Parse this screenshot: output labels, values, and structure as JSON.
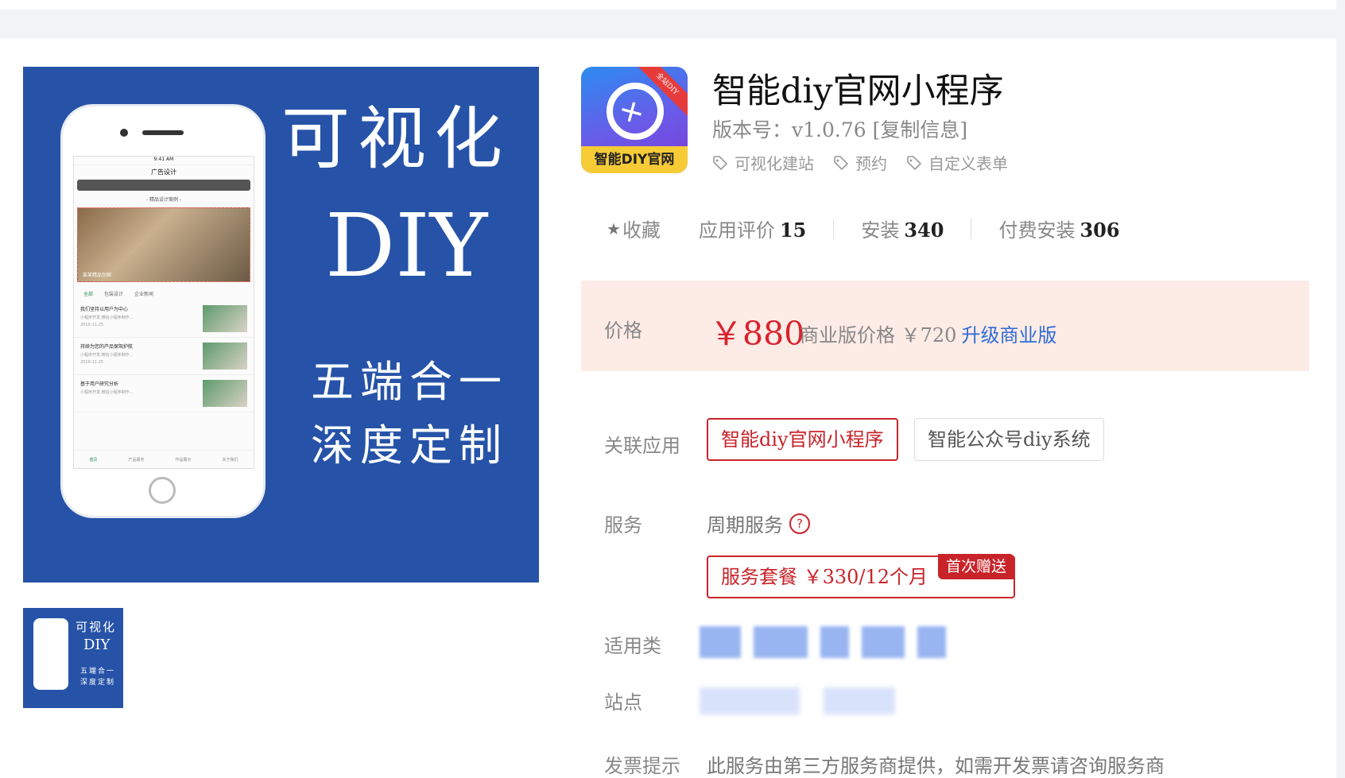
{
  "main_image": {
    "line1": "可视化",
    "line2": "DIY",
    "line3": "五端合一",
    "line4": "深度定制",
    "phone": {
      "status_time": "9:41 AM",
      "title": "广告设计",
      "sub": "- 精品设计案例 -",
      "hero_caption": "某某精品包邮",
      "tabs": [
        "全部",
        "包装设计",
        "企业新闻"
      ],
      "items": [
        {
          "title": "我们坚持以用户为中心",
          "desc": "小程序开发,微信小程序制作...",
          "date": "2019-11-25"
        },
        {
          "title": "持续为您的产品保驾护航",
          "desc": "小程序开发,微信小程序制作...",
          "date": "2019-11-25"
        },
        {
          "title": "基于用户研究分析",
          "desc": "小程序开发,微信小程序制作...",
          "date": ""
        }
      ],
      "nav": [
        "首页",
        "产品服务",
        "作品展示",
        "关于我们"
      ]
    }
  },
  "thumbnail": {
    "line1": "可视化",
    "line2": "DIY",
    "line3": "五端合一",
    "line4": "深度定制"
  },
  "app": {
    "icon_bottom_text": "智能DIY官网",
    "icon_ribbon_text": "全站DIY",
    "title": "智能diy官网小程序",
    "version_label": "版本号：",
    "version": "v1.0.76",
    "copy_info": "[复制信息]",
    "tags": [
      "可视化建站",
      "预约",
      "自定义表单"
    ]
  },
  "stats": {
    "favorite": "收藏",
    "reviews_label": "应用评价",
    "reviews": "15",
    "installs_label": "安装",
    "installs": "340",
    "paid_label": "付费安装",
    "paid": "306"
  },
  "price": {
    "label": "价格",
    "value": "￥880",
    "business_label": "商业版价格",
    "business_value": "￥720",
    "upgrade": "升级商业版"
  },
  "related": {
    "label": "关联应用",
    "apps": [
      "智能diy官网小程序",
      "智能公众号diy系统"
    ]
  },
  "service": {
    "label": "服务",
    "type": "周期服务",
    "help_icon": "?",
    "package": "服务套餐  ￥330/12个月",
    "badge": "首次赠送"
  },
  "applicable": {
    "label": "适用类"
  },
  "site": {
    "label": "站点"
  },
  "invoice": {
    "label": "发票提示",
    "text": "此服务由第三方服务商提供，如需开发票请咨询服务商"
  },
  "colors": {
    "brand_blue": "#2653a8",
    "accent_red": "#c9232a",
    "price_red": "#d9232d",
    "link_blue": "#2f6bd5",
    "price_bg": "#fdebe6"
  }
}
